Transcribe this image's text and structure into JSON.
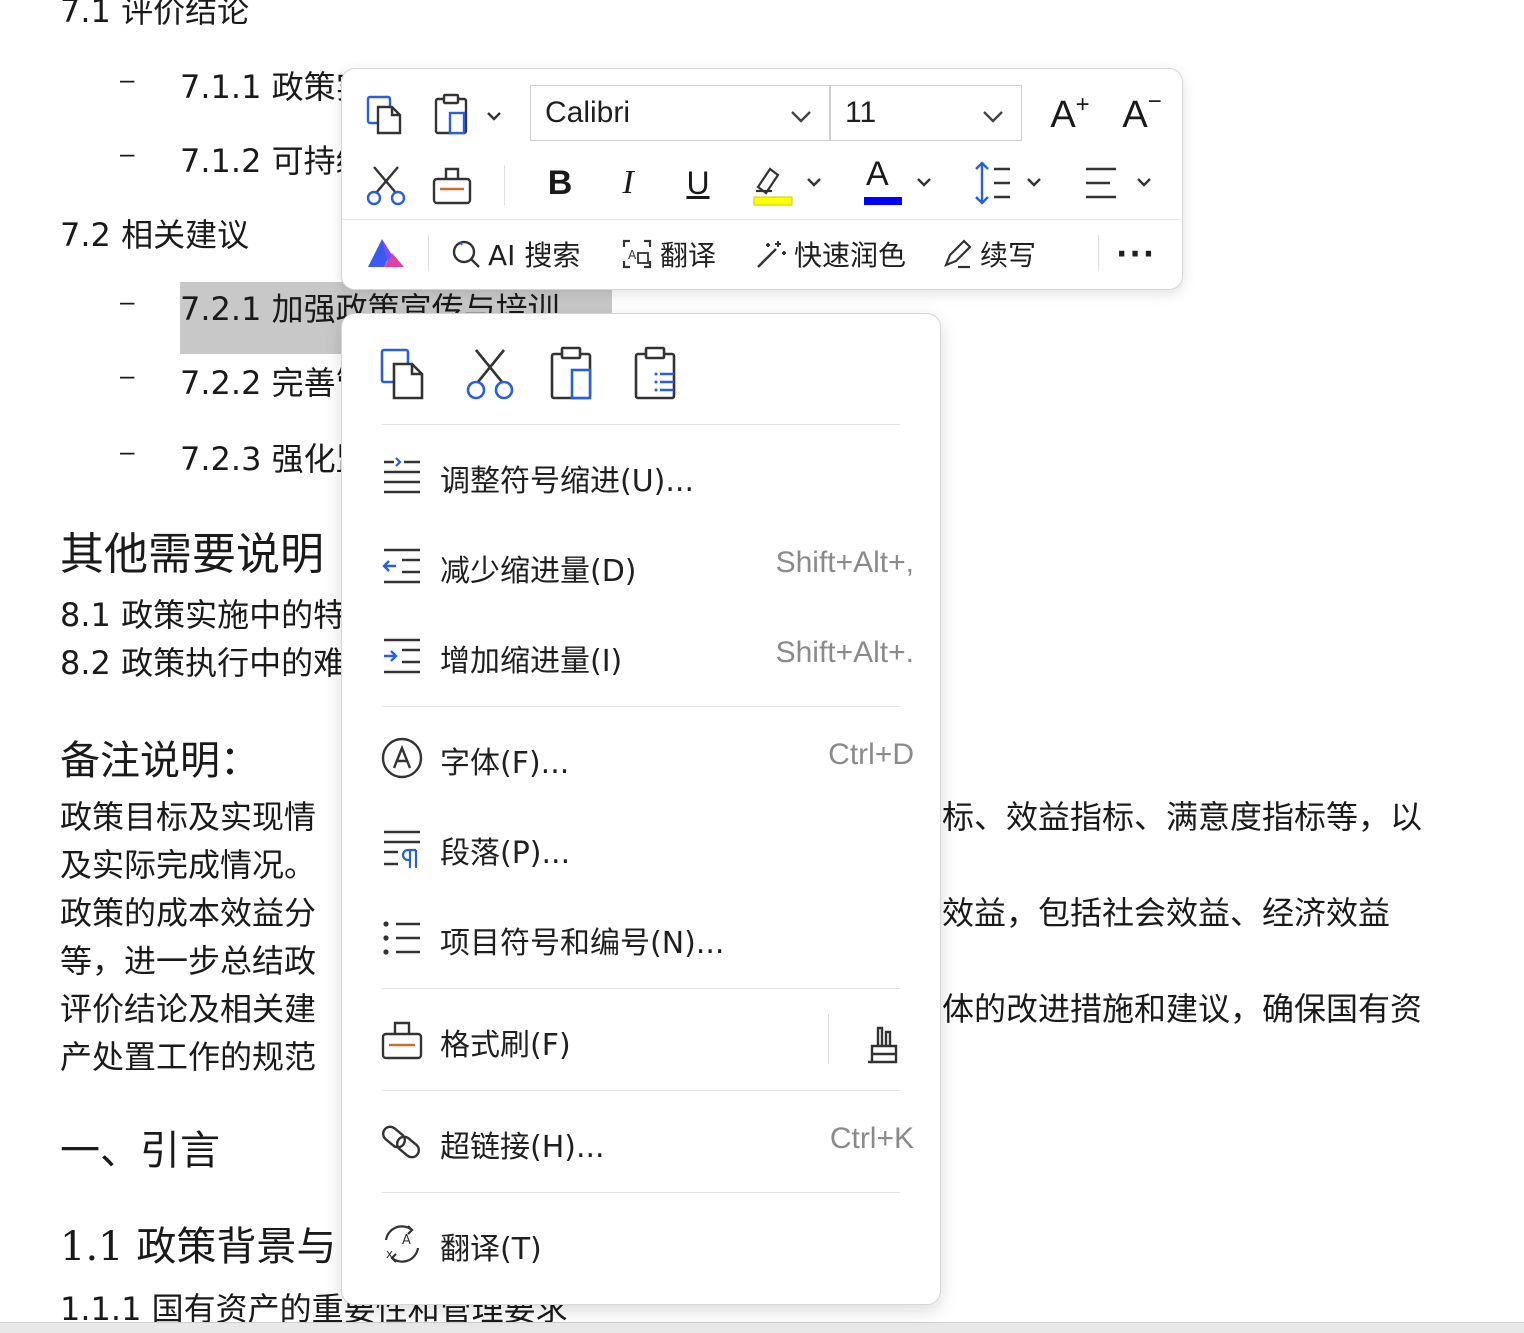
{
  "document": {
    "lines": [
      {
        "text": "7.1 评价结论"
      },
      {
        "text": "7.1.1 政策实施成效评价"
      },
      {
        "text": "7.1.2 可持续"
      },
      {
        "text": "7.2 相关建议"
      },
      {
        "text": "7.2.1 加强政策宣传与培训"
      },
      {
        "text": "7.2.2 完善管"
      },
      {
        "text": "7.2.3 强化监"
      },
      {
        "text": "其他需要说明"
      },
      {
        "text": "8.1 政策实施中的特"
      },
      {
        "text": "8.2 政策执行中的难"
      },
      {
        "text": "备注说明："
      },
      {
        "text": "政策目标及实现情"
      },
      {
        "text": "标、效益指标、满意度指标等，以"
      },
      {
        "text": "及实际完成情况。"
      },
      {
        "text": "政策的成本效益分"
      },
      {
        "text": "效益，包括社会效益、经济效益"
      },
      {
        "text": "等，进一步总结政"
      },
      {
        "text": "评价结论及相关建"
      },
      {
        "text": "体的改进措施和建议，确保国有资"
      },
      {
        "text": "产处置工作的规范"
      },
      {
        "text": "一、引言"
      },
      {
        "text": "1.1 政策背景与"
      },
      {
        "text": "1.1.1 国有资产的重要性和管理要求"
      }
    ],
    "bullet_symbol": "–"
  },
  "toolbar": {
    "font_name": "Calibri",
    "font_size": "11",
    "bold_label": "B",
    "italic_label": "I",
    "underline_label": "U",
    "font_color_label": "A",
    "grow_label": "A",
    "shrink_label": "A",
    "ai_items": [
      {
        "label": "AI 搜索"
      },
      {
        "label": "翻译"
      },
      {
        "label": "快速润色"
      },
      {
        "label": "续写"
      }
    ],
    "more_label": "···",
    "colors": {
      "highlight": "#ffff00",
      "font_color": "#0000ff",
      "accent": "#2b5fd9"
    }
  },
  "menu": {
    "items": [
      {
        "label": "调整符号缩进(U)...",
        "shortcut": ""
      },
      {
        "label": "减少缩进量(D)",
        "shortcut": "Shift+Alt+,"
      },
      {
        "label": "增加缩进量(I)",
        "shortcut": "Shift+Alt+."
      },
      {
        "label": "字体(F)...",
        "shortcut": "Ctrl+D"
      },
      {
        "label": "段落(P)...",
        "shortcut": ""
      },
      {
        "label": "项目符号和编号(N)...",
        "shortcut": ""
      },
      {
        "label": "格式刷(F)",
        "shortcut": ""
      },
      {
        "label": "超链接(H)...",
        "shortcut": "Ctrl+K"
      },
      {
        "label": "翻译(T)",
        "shortcut": ""
      }
    ]
  }
}
